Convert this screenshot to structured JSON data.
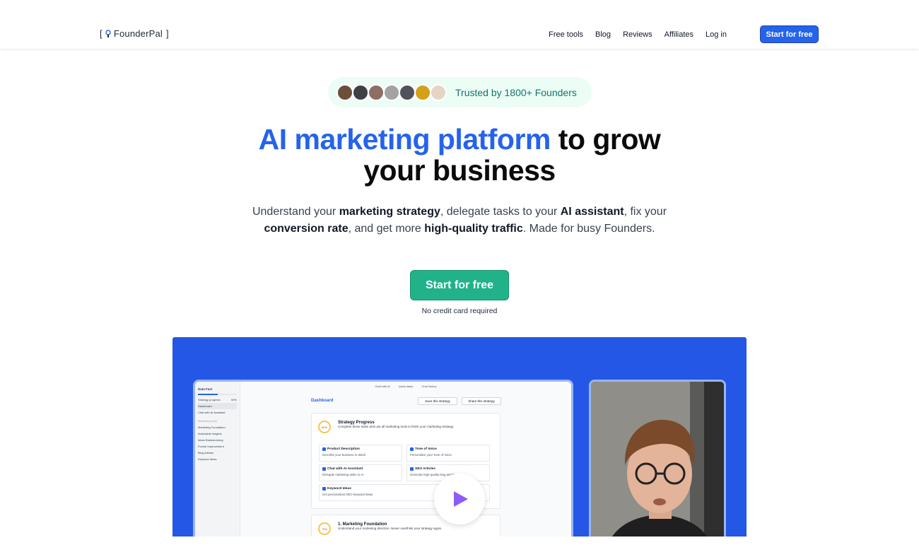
{
  "nav": {
    "logo_open": "[",
    "logo_text": "FounderPal",
    "logo_close": "]",
    "links": [
      "Free tools",
      "Blog",
      "Reviews",
      "Affiliates",
      "Log in"
    ],
    "cta": "Start for free"
  },
  "trust": {
    "text": "Trusted by 1800+ Founders",
    "avatar_count": 7
  },
  "hero": {
    "title_blue": "AI marketing platform",
    "title_rest_1": "to grow",
    "title_rest_2": "your business",
    "sub": [
      {
        "t": "Understand your ",
        "b": false
      },
      {
        "t": "marketing strategy",
        "b": true
      },
      {
        "t": ", delegate tasks to your ",
        "b": false
      },
      {
        "t": "AI assistant",
        "b": true
      },
      {
        "t": ", fix your ",
        "b": false
      },
      {
        "t": "conversion rate",
        "b": true
      },
      {
        "t": ", and get more ",
        "b": false
      },
      {
        "t": "high-quality traffic",
        "b": true
      },
      {
        "t": ". Made for busy Founders.",
        "b": false
      }
    ],
    "cta": "Start for free",
    "note": "No credit card required"
  },
  "app": {
    "project": "Data Fast",
    "progress_label": "Strategy progress",
    "progress_value": "50%",
    "progress_fraction": 0.5,
    "side_items": [
      "Dashboard",
      "Chat with AI Assistant"
    ],
    "tools_label": "Marketing tools",
    "tools": [
      "Marketing Foundation",
      "Actionable Insights",
      "Ideas Brainstorming",
      "Funnel Improvement",
      "Blog Articles",
      "Keyword Ideas"
    ],
    "top_links": [
      "Chat with AI",
      "Quick tasks",
      "Chat history"
    ],
    "dashboard": "Dashboard",
    "save_btn": "Save this strategy",
    "share_btn": "Share this strategy",
    "strategy": {
      "ring": "50%",
      "title": "Strategy Progress",
      "desc": "Complete these tasks and use all marketing tools to finish your marketing strategy."
    },
    "tasks": [
      {
        "title": "Product Description",
        "desc": "Describe your business in detail"
      },
      {
        "title": "Tone of Voice",
        "desc": "Personalize your Tone of Voice"
      },
      {
        "title": "Chat with AI Assistant",
        "desc": "Delegate marketing tasks to AI"
      },
      {
        "title": "SEO Articles",
        "desc": "Generate high-quality blog articles"
      },
      {
        "title": "Keyword Ideas",
        "desc": "Get personalized SEO keyword ideas"
      }
    ],
    "foundation": {
      "ring": "75%",
      "title": "1. Marketing Foundation",
      "desc": "Understand your marketing direction. Never overthink your strategy again."
    }
  },
  "colors": {
    "brand_blue": "#2563eb",
    "cta_green": "#22b28a",
    "trust_bg": "#ecfdf5",
    "trust_text": "#0f766e",
    "video_bg": "#2457e6"
  }
}
